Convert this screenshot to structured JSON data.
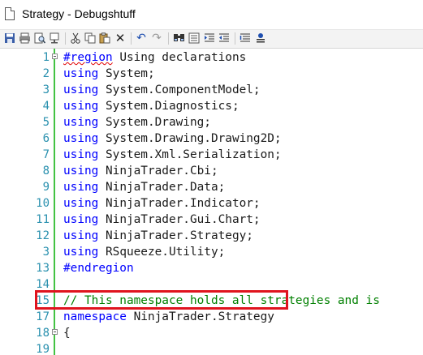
{
  "window": {
    "title": "Strategy - Debugshtuff"
  },
  "toolbar": {
    "icons": [
      "save-icon",
      "print-icon",
      "print-preview-icon",
      "page-setup-icon",
      "cut-icon",
      "copy-icon",
      "paste-icon",
      "delete-icon",
      "undo-icon",
      "redo-icon",
      "find-icon",
      "replace-icon",
      "indent-icon",
      "outdent-icon",
      "comment-icon",
      "uncomment-icon"
    ]
  },
  "editor": {
    "lines": [
      {
        "num": "1",
        "parts": [
          {
            "t": "#region",
            "c": "kw squig"
          },
          {
            "t": " Using declarations",
            "c": ""
          }
        ]
      },
      {
        "num": "2",
        "parts": [
          {
            "t": "using",
            "c": "kw"
          },
          {
            "t": " System;",
            "c": ""
          }
        ]
      },
      {
        "num": "3",
        "parts": [
          {
            "t": "using",
            "c": "kw"
          },
          {
            "t": " System.ComponentModel;",
            "c": ""
          }
        ]
      },
      {
        "num": "4",
        "parts": [
          {
            "t": "using",
            "c": "kw"
          },
          {
            "t": " System.Diagnostics;",
            "c": ""
          }
        ]
      },
      {
        "num": "5",
        "parts": [
          {
            "t": "using",
            "c": "kw"
          },
          {
            "t": " System.Drawing;",
            "c": ""
          }
        ]
      },
      {
        "num": "6",
        "parts": [
          {
            "t": "using",
            "c": "kw"
          },
          {
            "t": " System.Drawing.Drawing2D;",
            "c": ""
          }
        ]
      },
      {
        "num": "7",
        "parts": [
          {
            "t": "using",
            "c": "kw"
          },
          {
            "t": " System.Xml.Serialization;",
            "c": ""
          }
        ]
      },
      {
        "num": "8",
        "parts": [
          {
            "t": "using",
            "c": "kw"
          },
          {
            "t": " NinjaTrader.Cbi;",
            "c": ""
          }
        ]
      },
      {
        "num": "9",
        "parts": [
          {
            "t": "using",
            "c": "kw"
          },
          {
            "t": " NinjaTrader.Data;",
            "c": ""
          }
        ]
      },
      {
        "num": "10",
        "parts": [
          {
            "t": "using",
            "c": "kw"
          },
          {
            "t": " NinjaTrader.Indicator;",
            "c": ""
          }
        ]
      },
      {
        "num": "11",
        "parts": [
          {
            "t": "using",
            "c": "kw"
          },
          {
            "t": " NinjaTrader.Gui.Chart;",
            "c": ""
          }
        ]
      },
      {
        "num": "12",
        "parts": [
          {
            "t": "using",
            "c": "kw"
          },
          {
            "t": " NinjaTrader.Strategy;",
            "c": ""
          }
        ]
      },
      {
        "num": "3",
        "parts": [
          {
            "t": "using",
            "c": "kw"
          },
          {
            "t": " RSqueeze.Utility;",
            "c": ""
          }
        ]
      },
      {
        "num": "13",
        "parts": [
          {
            "t": "#endregion",
            "c": "kw"
          }
        ]
      },
      {
        "num": "14",
        "parts": []
      },
      {
        "num": "15",
        "parts": [
          {
            "t": "// This namespace holds all strategies and is",
            "c": "cm"
          }
        ]
      },
      {
        "num": "17",
        "parts": [
          {
            "t": "namespace",
            "c": "kw"
          },
          {
            "t": " NinjaTrader.Strategy",
            "c": ""
          }
        ]
      },
      {
        "num": "18",
        "parts": [
          {
            "t": "{",
            "c": ""
          }
        ]
      },
      {
        "num": "19",
        "parts": []
      }
    ]
  }
}
